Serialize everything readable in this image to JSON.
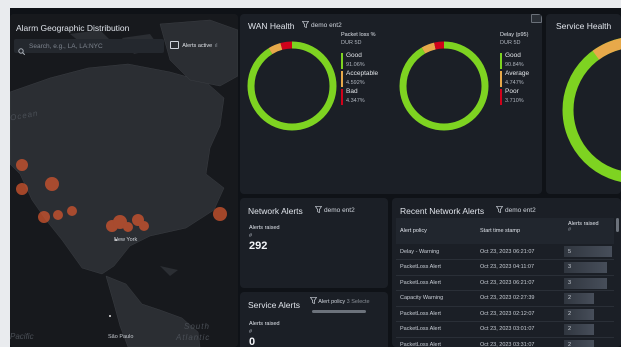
{
  "map": {
    "title": "Alarm Geographic Distribution",
    "search_placeholder": "Search, e.g., LA, LA:NYC",
    "alerts_toggle_label": "Alerts active",
    "labels": [
      "Ocean",
      "New York",
      "South",
      "Atlantic",
      "São Paulo",
      "Pacific"
    ]
  },
  "wan": {
    "title": "WAN Health",
    "filter": "demo ent2",
    "donuts": [
      {
        "metric": "Packet loss %",
        "period": "DUR 5D",
        "legend": [
          {
            "label": "Good",
            "value": "91.06%",
            "color": "#7ed321"
          },
          {
            "label": "Acceptable",
            "value": "4.592%",
            "color": "#e7a94a"
          },
          {
            "label": "Bad",
            "value": "4.347%",
            "color": "#d0021b"
          }
        ],
        "fractions": [
          0.9106,
          0.04592,
          0.04347
        ]
      },
      {
        "metric": "Delay (p95)",
        "period": "DUR 5D",
        "legend": [
          {
            "label": "Good",
            "value": "90.84%",
            "color": "#7ed321"
          },
          {
            "label": "Average",
            "value": "4.747%",
            "color": "#e7a94a"
          },
          {
            "label": "Poor",
            "value": "3.710%",
            "color": "#d0021b"
          }
        ],
        "fractions": [
          0.9084,
          0.04747,
          0.0371
        ]
      }
    ]
  },
  "service_health": {
    "title": "Service Health"
  },
  "network_alerts": {
    "title": "Network Alerts",
    "filter": "demo ent2",
    "raised_label": "Alerts raised",
    "raised_sub": "#",
    "raised_value": "292"
  },
  "service_alerts": {
    "title": "Service Alerts",
    "filter": "Alert policy",
    "filter_count": "3 Selecte",
    "raised_label": "Alerts raised",
    "raised_sub": "#",
    "raised_value": "0"
  },
  "recent": {
    "title": "Recent Network Alerts",
    "filter": "demo ent2",
    "columns": [
      "Alert policy",
      "Start time stamp",
      "Alerts raised"
    ],
    "rows": [
      {
        "policy": "Delay - Warning",
        "time": "Oct 23, 2023 06:21:07",
        "count": "5",
        "fill": 1.0
      },
      {
        "policy": "PacketLoss Alert",
        "time": "Oct 23, 2023 04:11:07",
        "count": "3",
        "fill": 0.9
      },
      {
        "policy": "PacketLoss Alert",
        "time": "Oct 23, 2023 06:21:07",
        "count": "3",
        "fill": 0.9
      },
      {
        "policy": "Capacity Warning",
        "time": "Oct 23, 2023 02:27:39",
        "count": "2",
        "fill": 0.62
      },
      {
        "policy": "PacketLoss Alert",
        "time": "Oct 23, 2023 02:12:07",
        "count": "2",
        "fill": 0.62
      },
      {
        "policy": "PacketLoss Alert",
        "time": "Oct 23, 2023 03:01:07",
        "count": "2",
        "fill": 0.62
      },
      {
        "policy": "PacketLoss Alert",
        "time": "Oct 23, 2023 03:31:07",
        "count": "2",
        "fill": 0.62
      }
    ]
  }
}
